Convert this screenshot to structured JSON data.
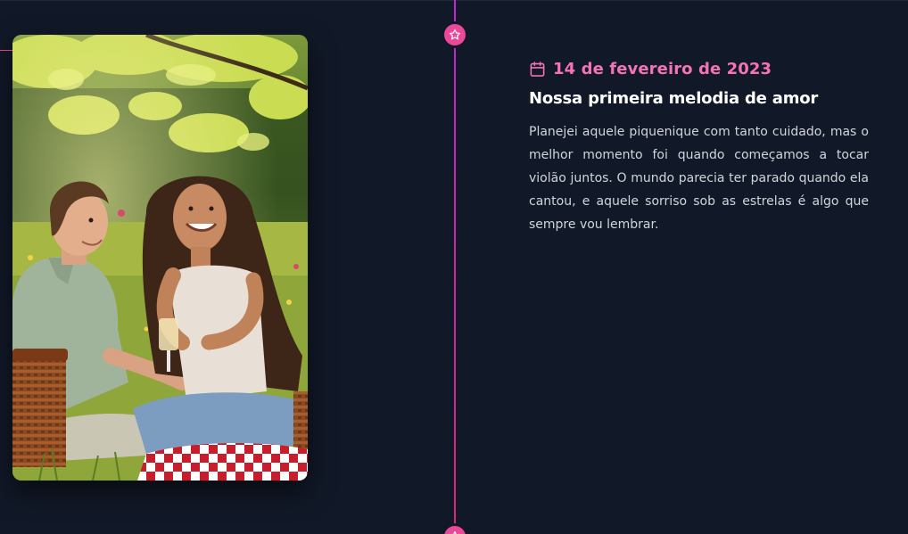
{
  "memory": {
    "date": "14 de fevereiro de 2023",
    "title": "Nossa primeira melodia de amor",
    "description": "Planejei aquele piquenique com tanto cuidado, mas o melhor momento foi quando começamos a tocar violão juntos. O mundo parecia ter parado quando ela cantou, e aquele sorriso sob as estrelas é algo que sempre vou lembrar."
  },
  "icons": {
    "timeline_node": "star-icon",
    "date": "calendar-icon"
  },
  "colors": {
    "background": "#111827",
    "accent_pink": "#ec4899",
    "date_text": "#f472b6",
    "title_text": "#ffffff",
    "body_text": "#d1d5db"
  }
}
